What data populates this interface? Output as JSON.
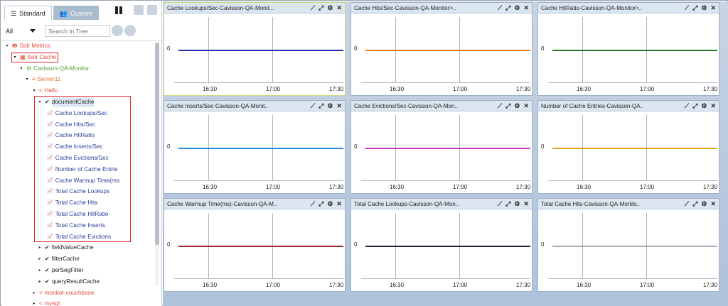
{
  "tabs": [
    {
      "label": "Standard",
      "icon": "list-icon",
      "active": true
    },
    {
      "label": "Custom",
      "icon": "users-icon",
      "active": false
    }
  ],
  "filter": {
    "value": "All",
    "placeholder": "Search In Tree"
  },
  "tree": [
    {
      "label": "Solr Metrics",
      "color": "#e24b3b",
      "icon": "printer-icon",
      "level": 0
    },
    {
      "label": "Solr Cache",
      "color": "#e24b3b",
      "icon": "grid-icon",
      "level": 1,
      "highlight": true
    },
    {
      "label": "Cavisson-QA-Monitor",
      "color": "#55a031",
      "icon": "gears-icon",
      "level": 2
    },
    {
      "label": "Server11",
      "color": "#e46f22",
      "icon": "server-icon",
      "level": 3
    },
    {
      "label": "Hello",
      "color": "#e24b3b",
      "icon": "share-icon",
      "level": 4
    },
    {
      "label": "documentCache",
      "color": "#222222",
      "icon": "check-icon",
      "level": 5
    },
    {
      "label": "Cache Lookups/Sec",
      "level": 6
    },
    {
      "label": "Cache Hits/Sec",
      "level": 6
    },
    {
      "label": "Cache HitRatio",
      "level": 6
    },
    {
      "label": "Cache Inserts/Sec",
      "level": 6
    },
    {
      "label": "Cache Evictions/Sec",
      "level": 6
    },
    {
      "label": "Number of Cache Entrie",
      "level": 6
    },
    {
      "label": "Cache Warmup Time(ms",
      "level": 6
    },
    {
      "label": "Total Cache Lookups",
      "level": 6
    },
    {
      "label": "Total Cache Hits",
      "level": 6
    },
    {
      "label": "Total Cache HitRatio",
      "level": 6
    },
    {
      "label": "Total Cache Inserts",
      "level": 6
    },
    {
      "label": "Total Cache Evictions",
      "level": 6
    },
    {
      "label": "fieldValueCache",
      "color": "#222222",
      "icon": "check-icon",
      "level": 5
    },
    {
      "label": "filterCache",
      "color": "#222222",
      "icon": "check-icon",
      "level": 5
    },
    {
      "label": "perSegFilter",
      "color": "#222222",
      "icon": "check-icon",
      "level": 5
    },
    {
      "label": "queryResultCache",
      "color": "#222222",
      "icon": "check-icon",
      "level": 5
    },
    {
      "label": "monitor-couchbase",
      "color": "#e24b3b",
      "icon": "share-icon",
      "level": 4
    },
    {
      "label": "mysql",
      "color": "#e24b3b",
      "icon": "share-icon",
      "level": 4
    }
  ],
  "panels": [
    {
      "title": "Cache Lookups/Sec-Cavisson-QA-Monit...",
      "color": "#1f2fa3",
      "selected": true
    },
    {
      "title": "Cache Hits/Sec-Cavisson-QA-Monitor>..",
      "color": "#f07a1c"
    },
    {
      "title": "Cache HitRatio-Cavisson-QA-Monitor>..",
      "color": "#1f7a2a"
    },
    {
      "title": "Cache Inserts/Sec-Cavisson-QA-Monit..",
      "color": "#2b8de3"
    },
    {
      "title": "Cache Evictions/Sec-Cavisson-QA-Mon..",
      "color": "#c43bd1"
    },
    {
      "title": "Number of Cache Entries-Cavisson-QA..",
      "color": "#e8a11a"
    },
    {
      "title": "Cache Warmup Time(ms)-Cavisson-QA-M..",
      "color": "#9c2a2a"
    },
    {
      "title": "Total Cache Lookups-Cavisson-QA-Mon..",
      "color": "#1c2233"
    },
    {
      "title": "Total Cache Hits-Cavisson-QA-Monito..",
      "color": "#a7aab0"
    }
  ],
  "chart_data": {
    "type": "line",
    "y_tick": "0",
    "x_ticks": [
      "16:30",
      "17:00",
      "17:30"
    ]
  }
}
